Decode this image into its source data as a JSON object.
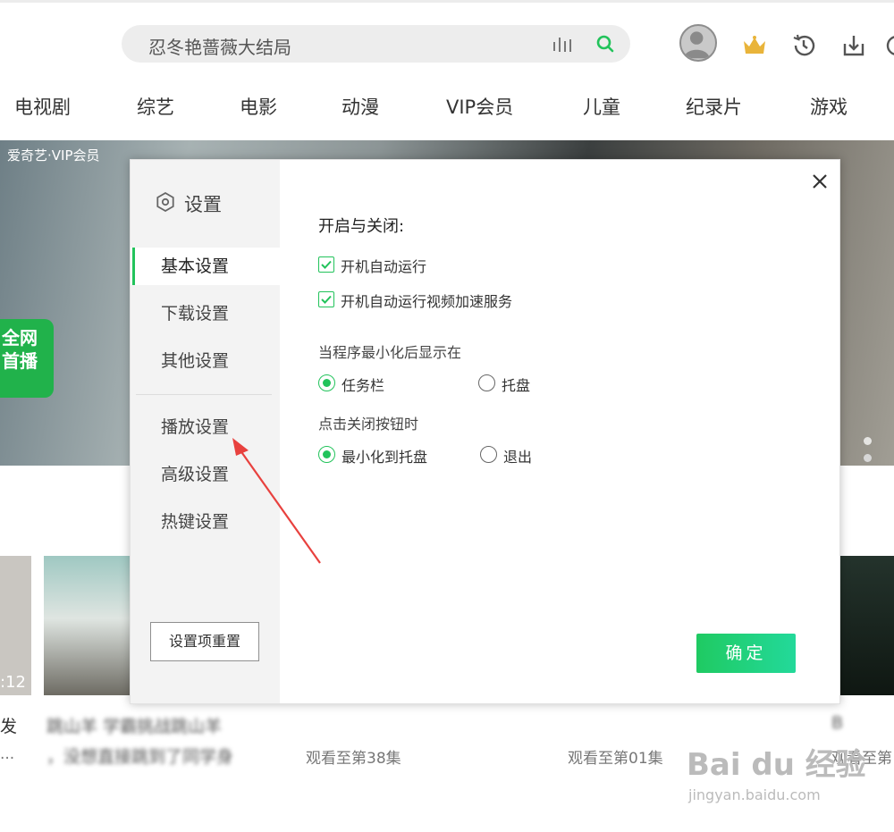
{
  "header": {
    "search_text": "忍冬艳蔷薇大结局"
  },
  "nav": {
    "items": [
      "电视剧",
      "综艺",
      "电影",
      "动漫",
      "VIP会员",
      "儿童",
      "纪录片",
      "游戏"
    ]
  },
  "banner": {
    "logo_text": "爱奇艺·VIP会员",
    "badge_text": "全网首播"
  },
  "dialog": {
    "title": "设置",
    "sidebar": {
      "items": [
        "基本设置",
        "下载设置",
        "其他设置",
        "播放设置",
        "高级设置",
        "热键设置"
      ],
      "active": "基本设置",
      "reset_label": "设置项重置"
    },
    "content": {
      "section_title": "开启与关闭:",
      "checkboxes": [
        {
          "label": "开机自动运行",
          "checked": true
        },
        {
          "label": "开机自动运行视频加速服务",
          "checked": true
        }
      ],
      "minimize_group": {
        "label": "当程序最小化后显示在",
        "options": [
          {
            "label": "任务栏",
            "selected": true
          },
          {
            "label": "托盘",
            "selected": false
          }
        ]
      },
      "close_group": {
        "label": "点击关闭按钮时",
        "options": [
          {
            "label": "最小化到托盘",
            "selected": true
          },
          {
            "label": "退出",
            "selected": false
          }
        ]
      }
    },
    "ok_label": "确定"
  },
  "videos": {
    "items": [
      {
        "duration": ":12",
        "caption": "发",
        "sub": "..."
      },
      {
        "caption": "跳山羊 学霸挑战跳山羊",
        "sub": "，没想直接跳到了同学身"
      },
      {
        "caption": "",
        "sub": "观看至第38集"
      },
      {
        "caption": "",
        "sub": "观看至第01集"
      },
      {
        "caption": "B",
        "sub": "观看至第"
      }
    ]
  },
  "watermark": {
    "main": "Bai du 经验",
    "sub": "jingyan.baidu.com"
  },
  "colors": {
    "accent": "#22c35b",
    "ok_button": "#1fca62"
  }
}
